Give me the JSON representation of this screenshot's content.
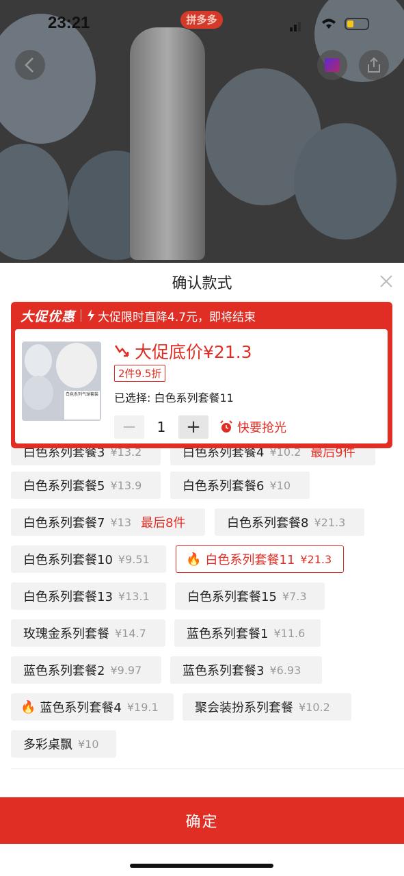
{
  "status_bar": {
    "time": "23:21",
    "app_badge": "拼多多"
  },
  "sheet": {
    "title": "确认款式"
  },
  "promo": {
    "label": "大促优惠",
    "message": "大促限时直降4.7元，即将结束",
    "price": "大促底价¥21.3",
    "discount": "2件9.5折",
    "selected": "已选择: 白色系列套餐11",
    "quantity": "1",
    "hurry": "快要抢光",
    "thumb_text": "白色系列气球套装"
  },
  "options": [
    {
      "name": "白色系列套餐3",
      "price": "¥13.2"
    },
    {
      "name": "白色系列套餐4",
      "price": "¥10.2",
      "tag": "最后9件"
    },
    {
      "name": "白色系列套餐5",
      "price": "¥13.9"
    },
    {
      "name": "白色系列套餐6",
      "price": "¥10"
    },
    {
      "name": "白色系列套餐7",
      "price": "¥13",
      "tag": "最后8件"
    },
    {
      "name": "白色系列套餐8",
      "price": "¥21.3"
    },
    {
      "name": "白色系列套餐10",
      "price": "¥9.51"
    },
    {
      "name": "白色系列套餐11",
      "price": "¥21.3"
    },
    {
      "name": "白色系列套餐13",
      "price": "¥13.1"
    },
    {
      "name": "白色系列套餐15",
      "price": "¥7.3"
    },
    {
      "name": "玫瑰金系列套餐",
      "price": "¥14.7"
    },
    {
      "name": "蓝色系列套餐1",
      "price": "¥11.6"
    },
    {
      "name": "蓝色系列套餐2",
      "price": "¥9.97"
    },
    {
      "name": "蓝色系列套餐3",
      "price": "¥6.93"
    },
    {
      "name": "蓝色系列套餐4",
      "price": "¥19.1"
    },
    {
      "name": "聚会装扮系列套餐",
      "price": "¥10.2"
    },
    {
      "name": "多彩桌飘",
      "price": "¥10"
    }
  ],
  "confirm_button": "确定",
  "colors": {
    "accent": "#e02e24",
    "chip_bg": "#f2f2f2"
  }
}
